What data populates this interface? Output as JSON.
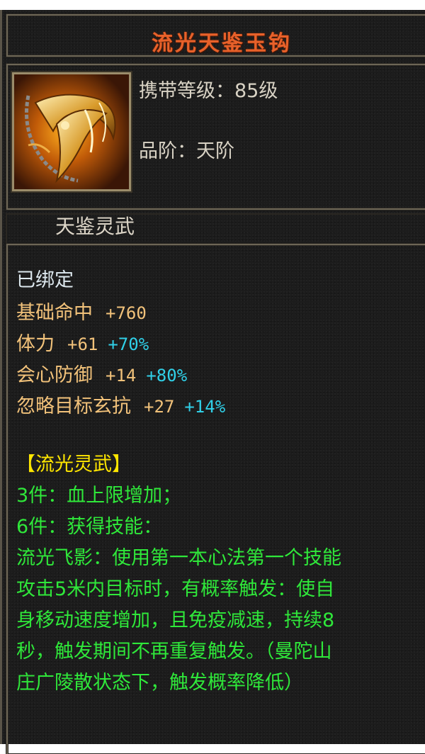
{
  "item": {
    "name": "流光天鉴玉钩",
    "icon": "hook-weapon-icon",
    "level_label": "携带等级：85级",
    "grade_label": "品阶：天阶",
    "type_label": "天鉴灵武"
  },
  "bound_status": "已绑定",
  "stats": [
    {
      "name": "基础命中",
      "value": "+760",
      "percent": ""
    },
    {
      "name": "体力",
      "value": "+61",
      "percent": "+70%"
    },
    {
      "name": "会心防御",
      "value": "+14",
      "percent": "+80%"
    },
    {
      "name": "忽略目标玄抗",
      "value": "+27",
      "percent": "+14%"
    }
  ],
  "set": {
    "title": "【流光灵武】",
    "lines": [
      "3件：血上限增加；",
      "6件：获得技能：",
      "流光飞影：使用第一本心法第一个技能",
      "攻击5米内目标时，有概率触发：使自",
      "身移动速度增加，且免疫减速，持续8",
      "秒，触发期间不再重复触发。（曼陀山",
      "庄广陵散状态下，触发概率降低）"
    ]
  },
  "colors": {
    "title": "#e8612a",
    "stat": "#f2c27a",
    "percent": "#30d0e8",
    "set_title": "#ffe600",
    "set_text": "#2fe83a",
    "bound": "#dde8ee"
  }
}
